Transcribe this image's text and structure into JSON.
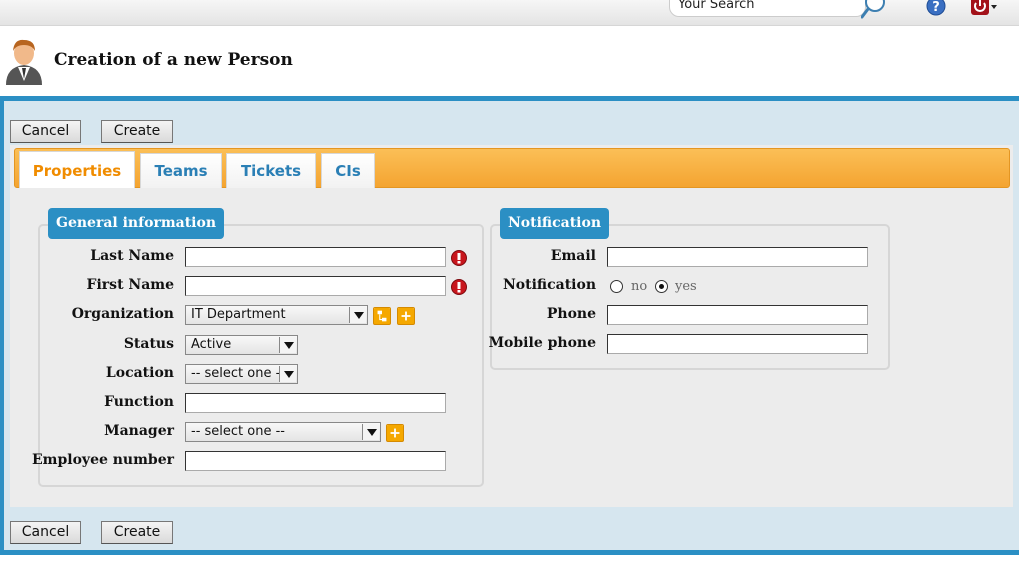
{
  "topbar": {
    "search_placeholder": "Your Search"
  },
  "header": {
    "title": "Creation of a new Person"
  },
  "actions": {
    "cancel_label": "Cancel",
    "create_label": "Create"
  },
  "tabs": [
    {
      "label": "Properties",
      "active": true
    },
    {
      "label": "Teams",
      "active": false
    },
    {
      "label": "Tickets",
      "active": false
    },
    {
      "label": "CIs",
      "active": false
    }
  ],
  "general": {
    "legend": "General information",
    "fields": {
      "last_name": {
        "label": "Last Name",
        "value": ""
      },
      "first_name": {
        "label": "First Name",
        "value": ""
      },
      "organization": {
        "label": "Organization",
        "value": "IT Department"
      },
      "status": {
        "label": "Status",
        "value": "Active"
      },
      "location": {
        "label": "Location",
        "value": "-- select one --"
      },
      "function": {
        "label": "Function",
        "value": ""
      },
      "manager": {
        "label": "Manager",
        "value": "-- select one --"
      },
      "employee_number": {
        "label": "Employee number",
        "value": ""
      }
    }
  },
  "notification": {
    "legend": "Notification",
    "fields": {
      "email": {
        "label": "Email",
        "value": ""
      },
      "notification": {
        "label": "Notification",
        "options": [
          "no",
          "yes"
        ],
        "selected": "yes"
      },
      "phone": {
        "label": "Phone",
        "value": ""
      },
      "mobile_phone": {
        "label": "Mobile phone",
        "value": ""
      }
    }
  },
  "colors": {
    "accent_blue": "#2b8fc4",
    "tab_orange": "#f4a431",
    "active_tab_text": "#f08c00",
    "tab_text": "#2a7fb5",
    "mandatory_red": "#c8161d"
  },
  "icons": {
    "search": "search-icon",
    "help": "help-icon",
    "power": "power-icon",
    "avatar": "person-avatar-icon",
    "mandatory": "mandatory-icon",
    "hierarchy": "hierarchy-icon",
    "add": "add-icon"
  }
}
